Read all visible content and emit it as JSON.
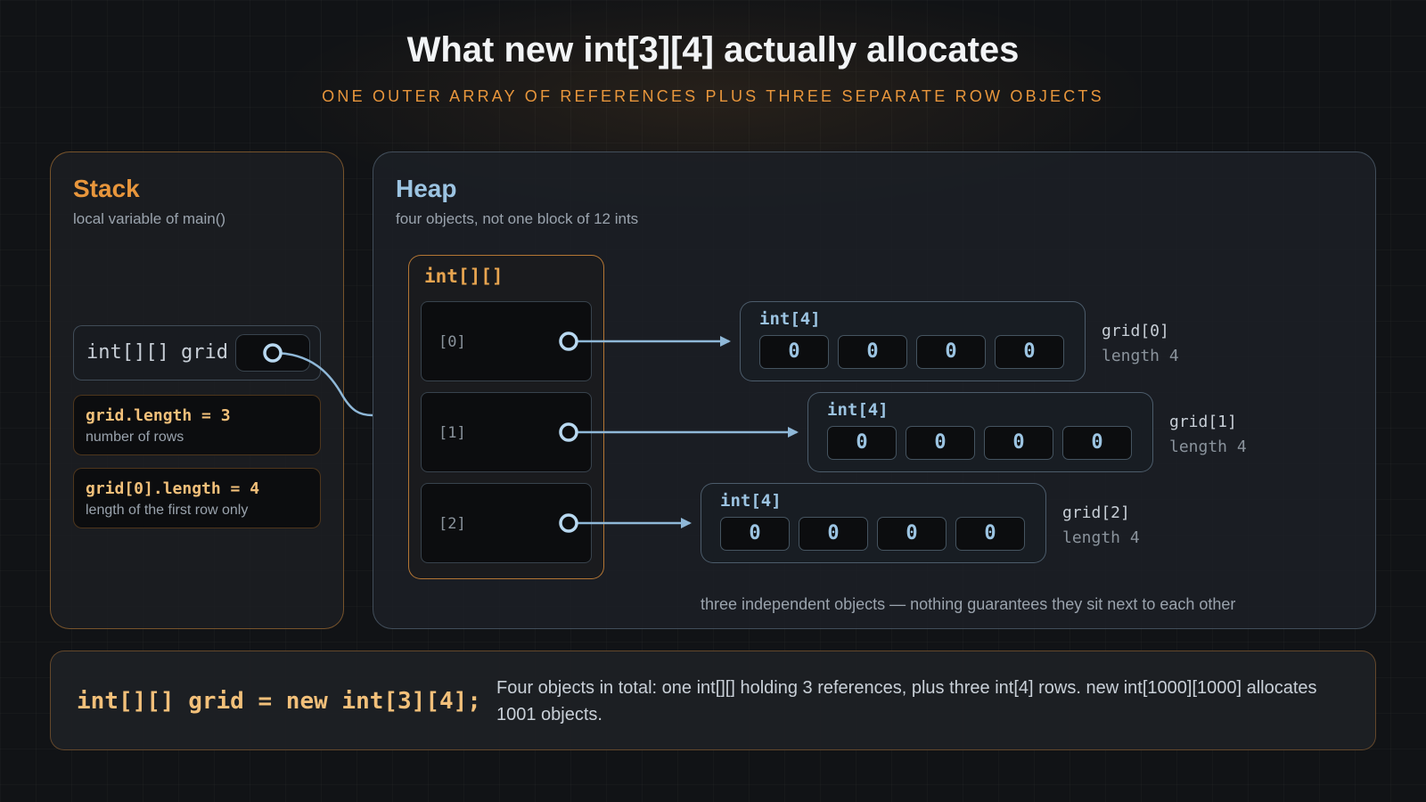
{
  "header": {
    "title": "What new int[3][4] actually allocates",
    "subtitle": "ONE OUTER ARRAY OF REFERENCES PLUS THREE SEPARATE ROW OBJECTS"
  },
  "stack": {
    "title": "Stack",
    "subtitle": "local variable of main()",
    "variable": "int[][] grid",
    "info": [
      {
        "code": "grid.length = 3",
        "desc": "number of rows"
      },
      {
        "code": "grid[0].length = 4",
        "desc": "length of the first row only"
      }
    ]
  },
  "heap": {
    "title": "Heap",
    "subtitle": "four objects, not one block of 12 ints",
    "outer_type": "int[][]",
    "slots": [
      "[0]",
      "[1]",
      "[2]"
    ],
    "rows": [
      {
        "type": "int[4]",
        "values": [
          "0",
          "0",
          "0",
          "0"
        ],
        "name": "grid[0]",
        "length": "length 4"
      },
      {
        "type": "int[4]",
        "values": [
          "0",
          "0",
          "0",
          "0"
        ],
        "name": "grid[1]",
        "length": "length 4"
      },
      {
        "type": "int[4]",
        "values": [
          "0",
          "0",
          "0",
          "0"
        ],
        "name": "grid[2]",
        "length": "length 4"
      }
    ],
    "note": "three independent objects — nothing guarantees they sit next to each other"
  },
  "footer": {
    "code": "int[][] grid = new int[3][4];",
    "summary": "Four objects in total: one int[][] holding 3 references, plus three int[4] rows. new int[1000][1000] allocates 1001 objects."
  },
  "colors": {
    "accent_orange": "#e8963c",
    "accent_blue": "#8fb8d8",
    "background": "#111316"
  }
}
